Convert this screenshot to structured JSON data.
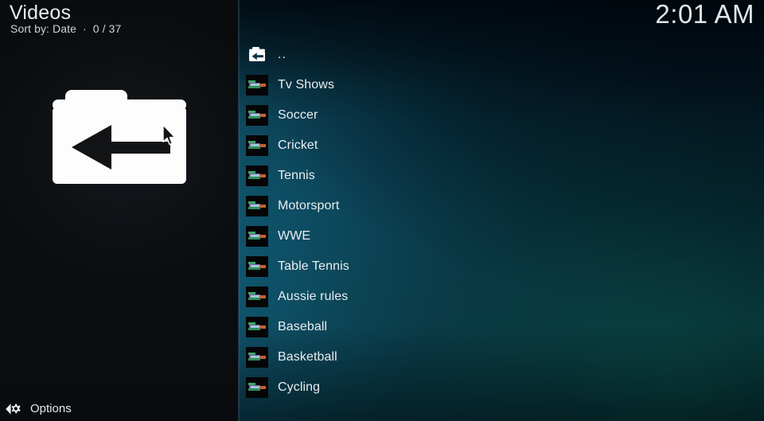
{
  "header": {
    "title": "Videos",
    "sort_line": "Sort by: Date  ·  0 / 37",
    "clock": "2:01 AM"
  },
  "footer": {
    "options_label": "Options",
    "options_icon": "options-chevron-gear-icon"
  },
  "preview": {
    "icon": "parent-folder-back-icon"
  },
  "cursor": {
    "icon": "mouse-pointer-icon"
  },
  "list": {
    "items": [
      {
        "label": "..",
        "icon": "parent-folder-icon",
        "type": "parent"
      },
      {
        "label": "Tv Shows",
        "icon": "folder-thumb-icon",
        "type": "folder"
      },
      {
        "label": "Soccer",
        "icon": "folder-thumb-icon",
        "type": "folder"
      },
      {
        "label": "Cricket",
        "icon": "folder-thumb-icon",
        "type": "folder"
      },
      {
        "label": "Tennis",
        "icon": "folder-thumb-icon",
        "type": "folder"
      },
      {
        "label": "Motorsport",
        "icon": "folder-thumb-icon",
        "type": "folder"
      },
      {
        "label": "WWE",
        "icon": "folder-thumb-icon",
        "type": "folder"
      },
      {
        "label": "Table Tennis",
        "icon": "folder-thumb-icon",
        "type": "folder"
      },
      {
        "label": "Aussie rules",
        "icon": "folder-thumb-icon",
        "type": "folder"
      },
      {
        "label": "Baseball",
        "icon": "folder-thumb-icon",
        "type": "folder"
      },
      {
        "label": "Basketball",
        "icon": "folder-thumb-icon",
        "type": "folder"
      },
      {
        "label": "Cycling",
        "icon": "folder-thumb-icon",
        "type": "folder"
      }
    ]
  },
  "colors": {
    "background_teal": "#0e4e64",
    "background_dark": "#04222c",
    "panel_black": "#0a0c0e",
    "text_primary": "#e9eef0",
    "text_secondary": "#cdd3d6"
  }
}
